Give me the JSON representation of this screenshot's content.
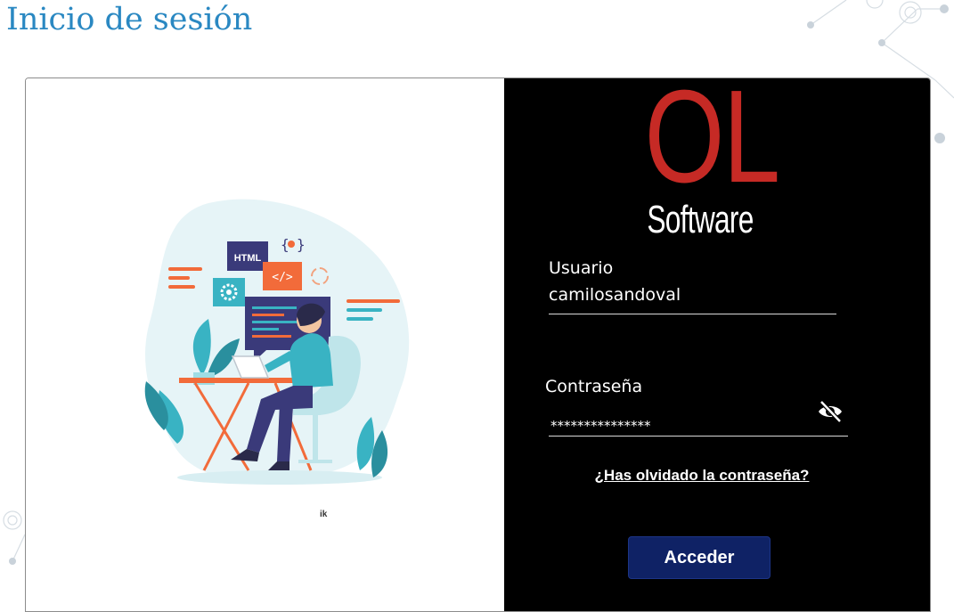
{
  "page": {
    "title": "Inicio de sesión"
  },
  "illustration": {
    "credit": "ik",
    "icon": "developer-at-desk-illustration"
  },
  "logo": {
    "top": "OL",
    "bottom": "Software"
  },
  "form": {
    "username_label": "Usuario",
    "username_value": "camilosandoval",
    "password_label": "Contraseña",
    "password_value": "***************",
    "toggle_icon": "eye-off-icon",
    "forgot_label": "¿Has olvidado la contraseña?",
    "submit_label": "Acceder"
  },
  "colors": {
    "title": "#2a88c2",
    "logo_red": "#c62a25",
    "right_panel": "#000000",
    "button": "#0f2265"
  }
}
